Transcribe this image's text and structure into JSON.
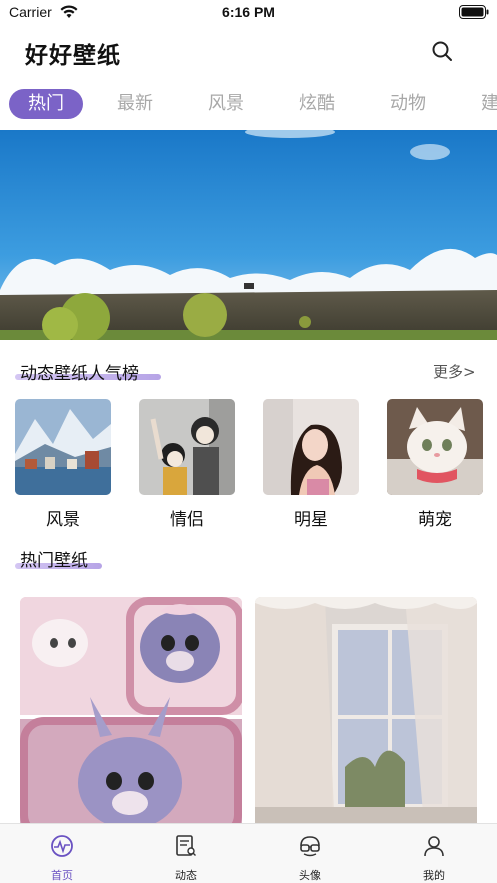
{
  "status_bar": {
    "carrier": "Carrier",
    "time": "6:16 PM"
  },
  "header": {
    "title": "好好壁纸",
    "search_icon": "search-icon"
  },
  "tabs": [
    {
      "label": "热门",
      "active": true
    },
    {
      "label": "最新",
      "active": false
    },
    {
      "label": "风景",
      "active": false
    },
    {
      "label": "炫酷",
      "active": false
    },
    {
      "label": "动物",
      "active": false
    },
    {
      "label": "建",
      "active": false
    }
  ],
  "sections": {
    "dynamic": {
      "title": "动态壁纸人气榜",
      "more": "更多>"
    },
    "hot": {
      "title": "热门壁纸"
    }
  },
  "categories": [
    {
      "label": "风景"
    },
    {
      "label": "情侣"
    },
    {
      "label": "明星"
    },
    {
      "label": "萌宠"
    }
  ],
  "bottom_nav": [
    {
      "label": "首页",
      "icon": "home-pulse-icon",
      "active": true
    },
    {
      "label": "动态",
      "icon": "document-search-icon",
      "active": false
    },
    {
      "label": "头像",
      "icon": "avatar-glasses-icon",
      "active": false
    },
    {
      "label": "我的",
      "icon": "user-icon",
      "active": false
    }
  ],
  "colors": {
    "accent": "#7b63c7",
    "tab_inactive": "#a8a8a8"
  }
}
